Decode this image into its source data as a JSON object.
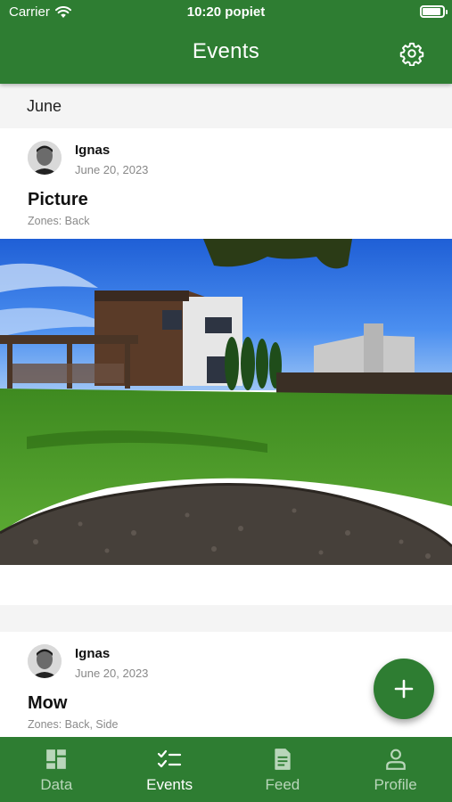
{
  "status_bar": {
    "carrier": "Carrier",
    "time": "10:20 popiet",
    "battery_level": 0.9
  },
  "app_bar": {
    "title": "Events",
    "settings_icon": "gear-icon"
  },
  "section": {
    "month": "June"
  },
  "events": [
    {
      "author": "Ignas",
      "date": "June 20, 2023",
      "title": "Picture",
      "zones": "Zones: Back"
    },
    {
      "author": "Ignas",
      "date": "June 20, 2023",
      "title": "Mow",
      "zones": "Zones: Back, Side"
    }
  ],
  "fab": {
    "icon": "plus-icon"
  },
  "bottom_nav": {
    "items": [
      {
        "label": "Data",
        "icon": "dashboard-icon",
        "active": false
      },
      {
        "label": "Events",
        "icon": "checklist-icon",
        "active": true
      },
      {
        "label": "Feed",
        "icon": "document-icon",
        "active": false
      },
      {
        "label": "Profile",
        "icon": "person-icon",
        "active": false
      }
    ]
  },
  "colors": {
    "primary": "#2e7d32",
    "background": "#f4f4f4",
    "nav_inactive": "#b9d6ba"
  }
}
